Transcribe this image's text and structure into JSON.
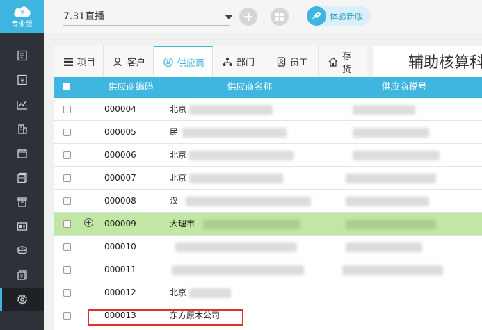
{
  "sidebar": {
    "logo_text": "专业版",
    "icons": [
      "ledger-icon",
      "voucher-icon",
      "report-chart-icon",
      "building-icon",
      "calendar-icon",
      "document-icon",
      "archive-icon",
      "image-card-icon",
      "cash-icon",
      "book-icon",
      "settings-icon"
    ]
  },
  "topbar": {
    "account_select_value": "7.31直播",
    "trial_button_label": "体验新版"
  },
  "tabs": [
    {
      "label": "项目",
      "icon": "list-icon"
    },
    {
      "label": "客户",
      "icon": "user-icon"
    },
    {
      "label": "供应商",
      "icon": "supplier-icon"
    },
    {
      "label": "部门",
      "icon": "org-chart-icon"
    },
    {
      "label": "员工",
      "icon": "badge-icon"
    },
    {
      "label": "存货",
      "icon": "house-icon"
    }
  ],
  "page_title": "辅助核算科",
  "grid": {
    "headers": [
      "供应商编码",
      "供应商名称",
      "供应商税号"
    ],
    "rows": [
      {
        "code": "000004",
        "name": "北京"
      },
      {
        "code": "000005",
        "name": "民"
      },
      {
        "code": "000006",
        "name": "北京"
      },
      {
        "code": "000007",
        "name": "北京"
      },
      {
        "code": "000008",
        "name": "汉"
      },
      {
        "code": "000009",
        "name": "大理市"
      },
      {
        "code": "000010",
        "name": ""
      },
      {
        "code": "000011",
        "name": ""
      },
      {
        "code": "000012",
        "name": "北京"
      },
      {
        "code": "000013",
        "name": "东方原木公司"
      }
    ]
  },
  "colors": {
    "accent": "#3fb6e0",
    "sidebar_bg": "#2e3238",
    "highlight_row": "#c2e7a4",
    "annotation_red": "#e0302b"
  }
}
